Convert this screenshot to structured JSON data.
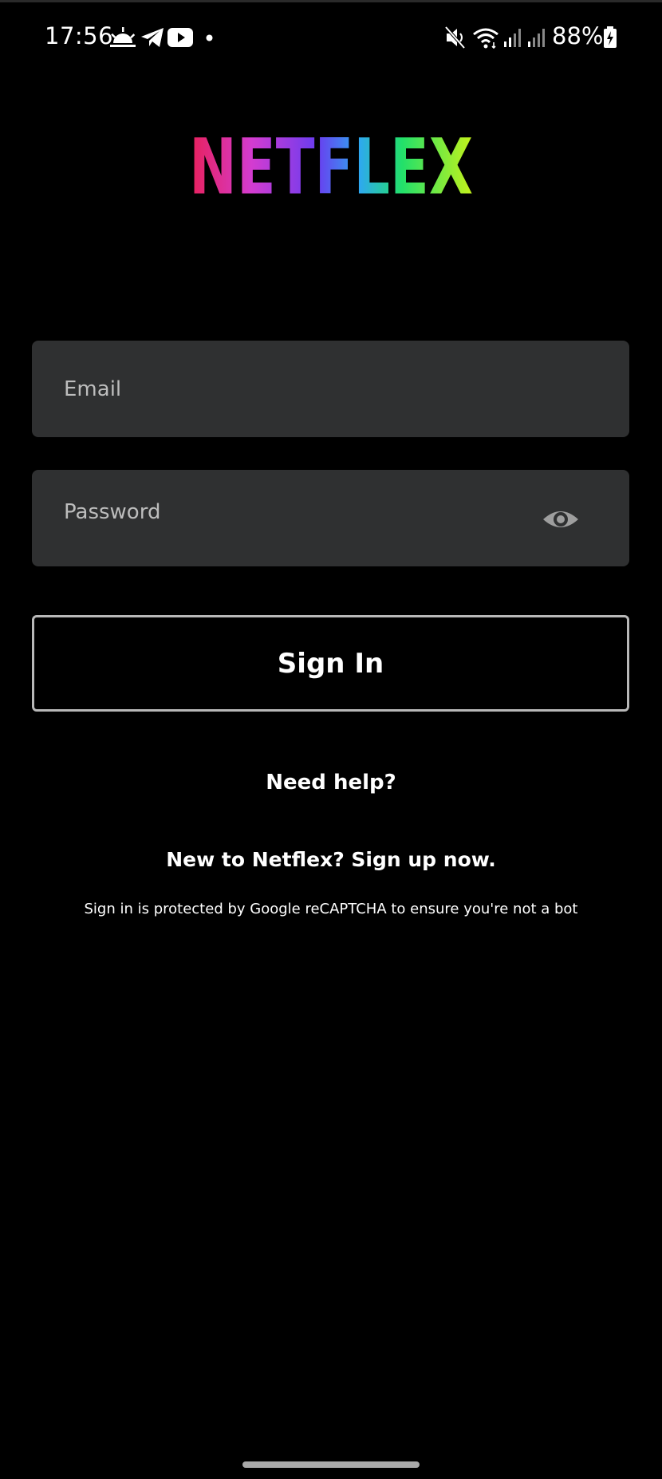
{
  "status_bar": {
    "time": "17:56",
    "battery": "88%",
    "icons": [
      "weather-sunrise-icon",
      "telegram-icon",
      "youtube-icon",
      "notification-dot-icon",
      "mute-icon",
      "wifi-icon",
      "signal-icon",
      "signal-2-icon",
      "battery-charging-icon"
    ]
  },
  "logo": {
    "text": "NETFLEX"
  },
  "form": {
    "email_placeholder": "Email",
    "password_placeholder": "Password",
    "show_password_icon": "eye-icon",
    "sign_in_label": "Sign In"
  },
  "links": {
    "need_help": "Need help?",
    "signup": "New to Netflex? Sign up now."
  },
  "footer": {
    "recaptcha": "Sign in is protected by Google reCAPTCHA to ensure you're not a bot"
  },
  "colors": {
    "background": "#000000",
    "field_bg": "#2f3031",
    "button_border": "#b8b8b8"
  }
}
